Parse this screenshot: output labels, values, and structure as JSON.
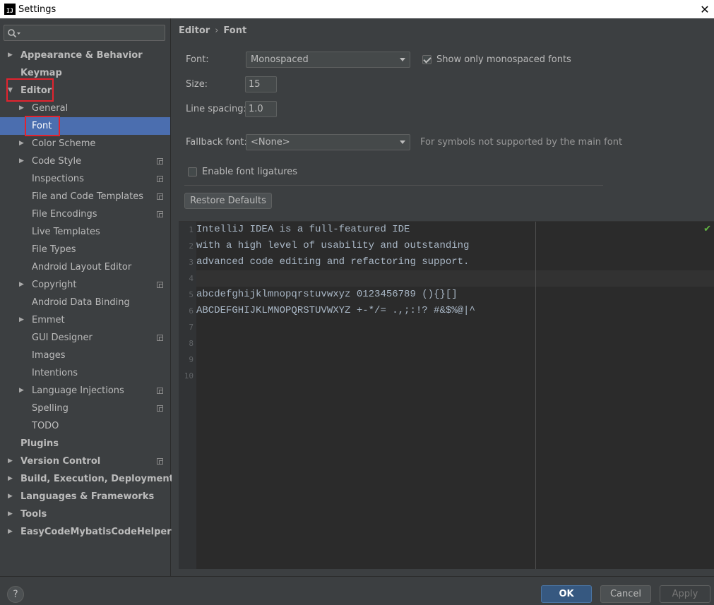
{
  "window": {
    "title": "Settings",
    "app_icon_text": "IJ"
  },
  "sidebar": {
    "search_placeholder": "",
    "items": [
      {
        "label": "Appearance & Behavior",
        "level": 0,
        "arrow": "right"
      },
      {
        "label": "Keymap",
        "level": 0,
        "arrow": ""
      },
      {
        "label": "Editor",
        "level": 0,
        "arrow": "down"
      },
      {
        "label": "General",
        "level": 1,
        "arrow": "right"
      },
      {
        "label": "Font",
        "level": 1,
        "arrow": "",
        "selected": true
      },
      {
        "label": "Color Scheme",
        "level": 1,
        "arrow": "right"
      },
      {
        "label": "Code Style",
        "level": 1,
        "arrow": "right",
        "project": true
      },
      {
        "label": "Inspections",
        "level": 1,
        "arrow": "",
        "project": true
      },
      {
        "label": "File and Code Templates",
        "level": 1,
        "arrow": "",
        "project": true
      },
      {
        "label": "File Encodings",
        "level": 1,
        "arrow": "",
        "project": true
      },
      {
        "label": "Live Templates",
        "level": 1,
        "arrow": ""
      },
      {
        "label": "File Types",
        "level": 1,
        "arrow": ""
      },
      {
        "label": "Android Layout Editor",
        "level": 1,
        "arrow": ""
      },
      {
        "label": "Copyright",
        "level": 1,
        "arrow": "right",
        "project": true
      },
      {
        "label": "Android Data Binding",
        "level": 1,
        "arrow": ""
      },
      {
        "label": "Emmet",
        "level": 1,
        "arrow": "right"
      },
      {
        "label": "GUI Designer",
        "level": 1,
        "arrow": "",
        "project": true
      },
      {
        "label": "Images",
        "level": 1,
        "arrow": ""
      },
      {
        "label": "Intentions",
        "level": 1,
        "arrow": ""
      },
      {
        "label": "Language Injections",
        "level": 1,
        "arrow": "right",
        "project": true
      },
      {
        "label": "Spelling",
        "level": 1,
        "arrow": "",
        "project": true
      },
      {
        "label": "TODO",
        "level": 1,
        "arrow": ""
      },
      {
        "label": "Plugins",
        "level": 0,
        "arrow": ""
      },
      {
        "label": "Version Control",
        "level": 0,
        "arrow": "right",
        "project": true
      },
      {
        "label": "Build, Execution, Deployment",
        "level": 0,
        "arrow": "right"
      },
      {
        "label": "Languages & Frameworks",
        "level": 0,
        "arrow": "right"
      },
      {
        "label": "Tools",
        "level": 0,
        "arrow": "right"
      },
      {
        "label": "EasyCodeMybatisCodeHelperPro",
        "level": 0,
        "arrow": "right"
      }
    ]
  },
  "breadcrumb": {
    "parent": "Editor",
    "separator": "›",
    "current": "Font"
  },
  "font_settings": {
    "font_label": "Font:",
    "font_value": "Monospaced",
    "monospaced_only_label": "Show only monospaced fonts",
    "monospaced_only_checked": true,
    "size_label": "Size:",
    "size_value": "15",
    "line_spacing_label": "Line spacing:",
    "line_spacing_value": "1.0",
    "fallback_label": "Fallback font:",
    "fallback_value": "<None>",
    "fallback_hint": "For symbols not supported by the main font",
    "ligatures_label": "Enable font ligatures",
    "ligatures_checked": false,
    "restore_button": "Restore Defaults"
  },
  "preview": {
    "line_numbers": [
      "1",
      "2",
      "3",
      "4",
      "5",
      "6",
      "7",
      "8",
      "9",
      "10"
    ],
    "lines": [
      "IntelliJ IDEA is a full-featured IDE",
      "with a high level of usability and outstanding",
      "advanced code editing and refactoring support.",
      "",
      "abcdefghijklmnopqrstuvwxyz 0123456789 (){}[]",
      "ABCDEFGHIJKLMNOPQRSTUVWXYZ +-*/= .,;:!? #&$%@|^",
      "",
      "",
      "",
      ""
    ],
    "current_line": 4,
    "status_icon": "checkmark-icon"
  },
  "footer": {
    "help_label": "?",
    "ok_label": "OK",
    "cancel_label": "Cancel",
    "apply_label": "Apply"
  },
  "colors": {
    "accent": "#4b6eaf",
    "highlight_box": "#e3232e",
    "ok_button": "#365880"
  }
}
